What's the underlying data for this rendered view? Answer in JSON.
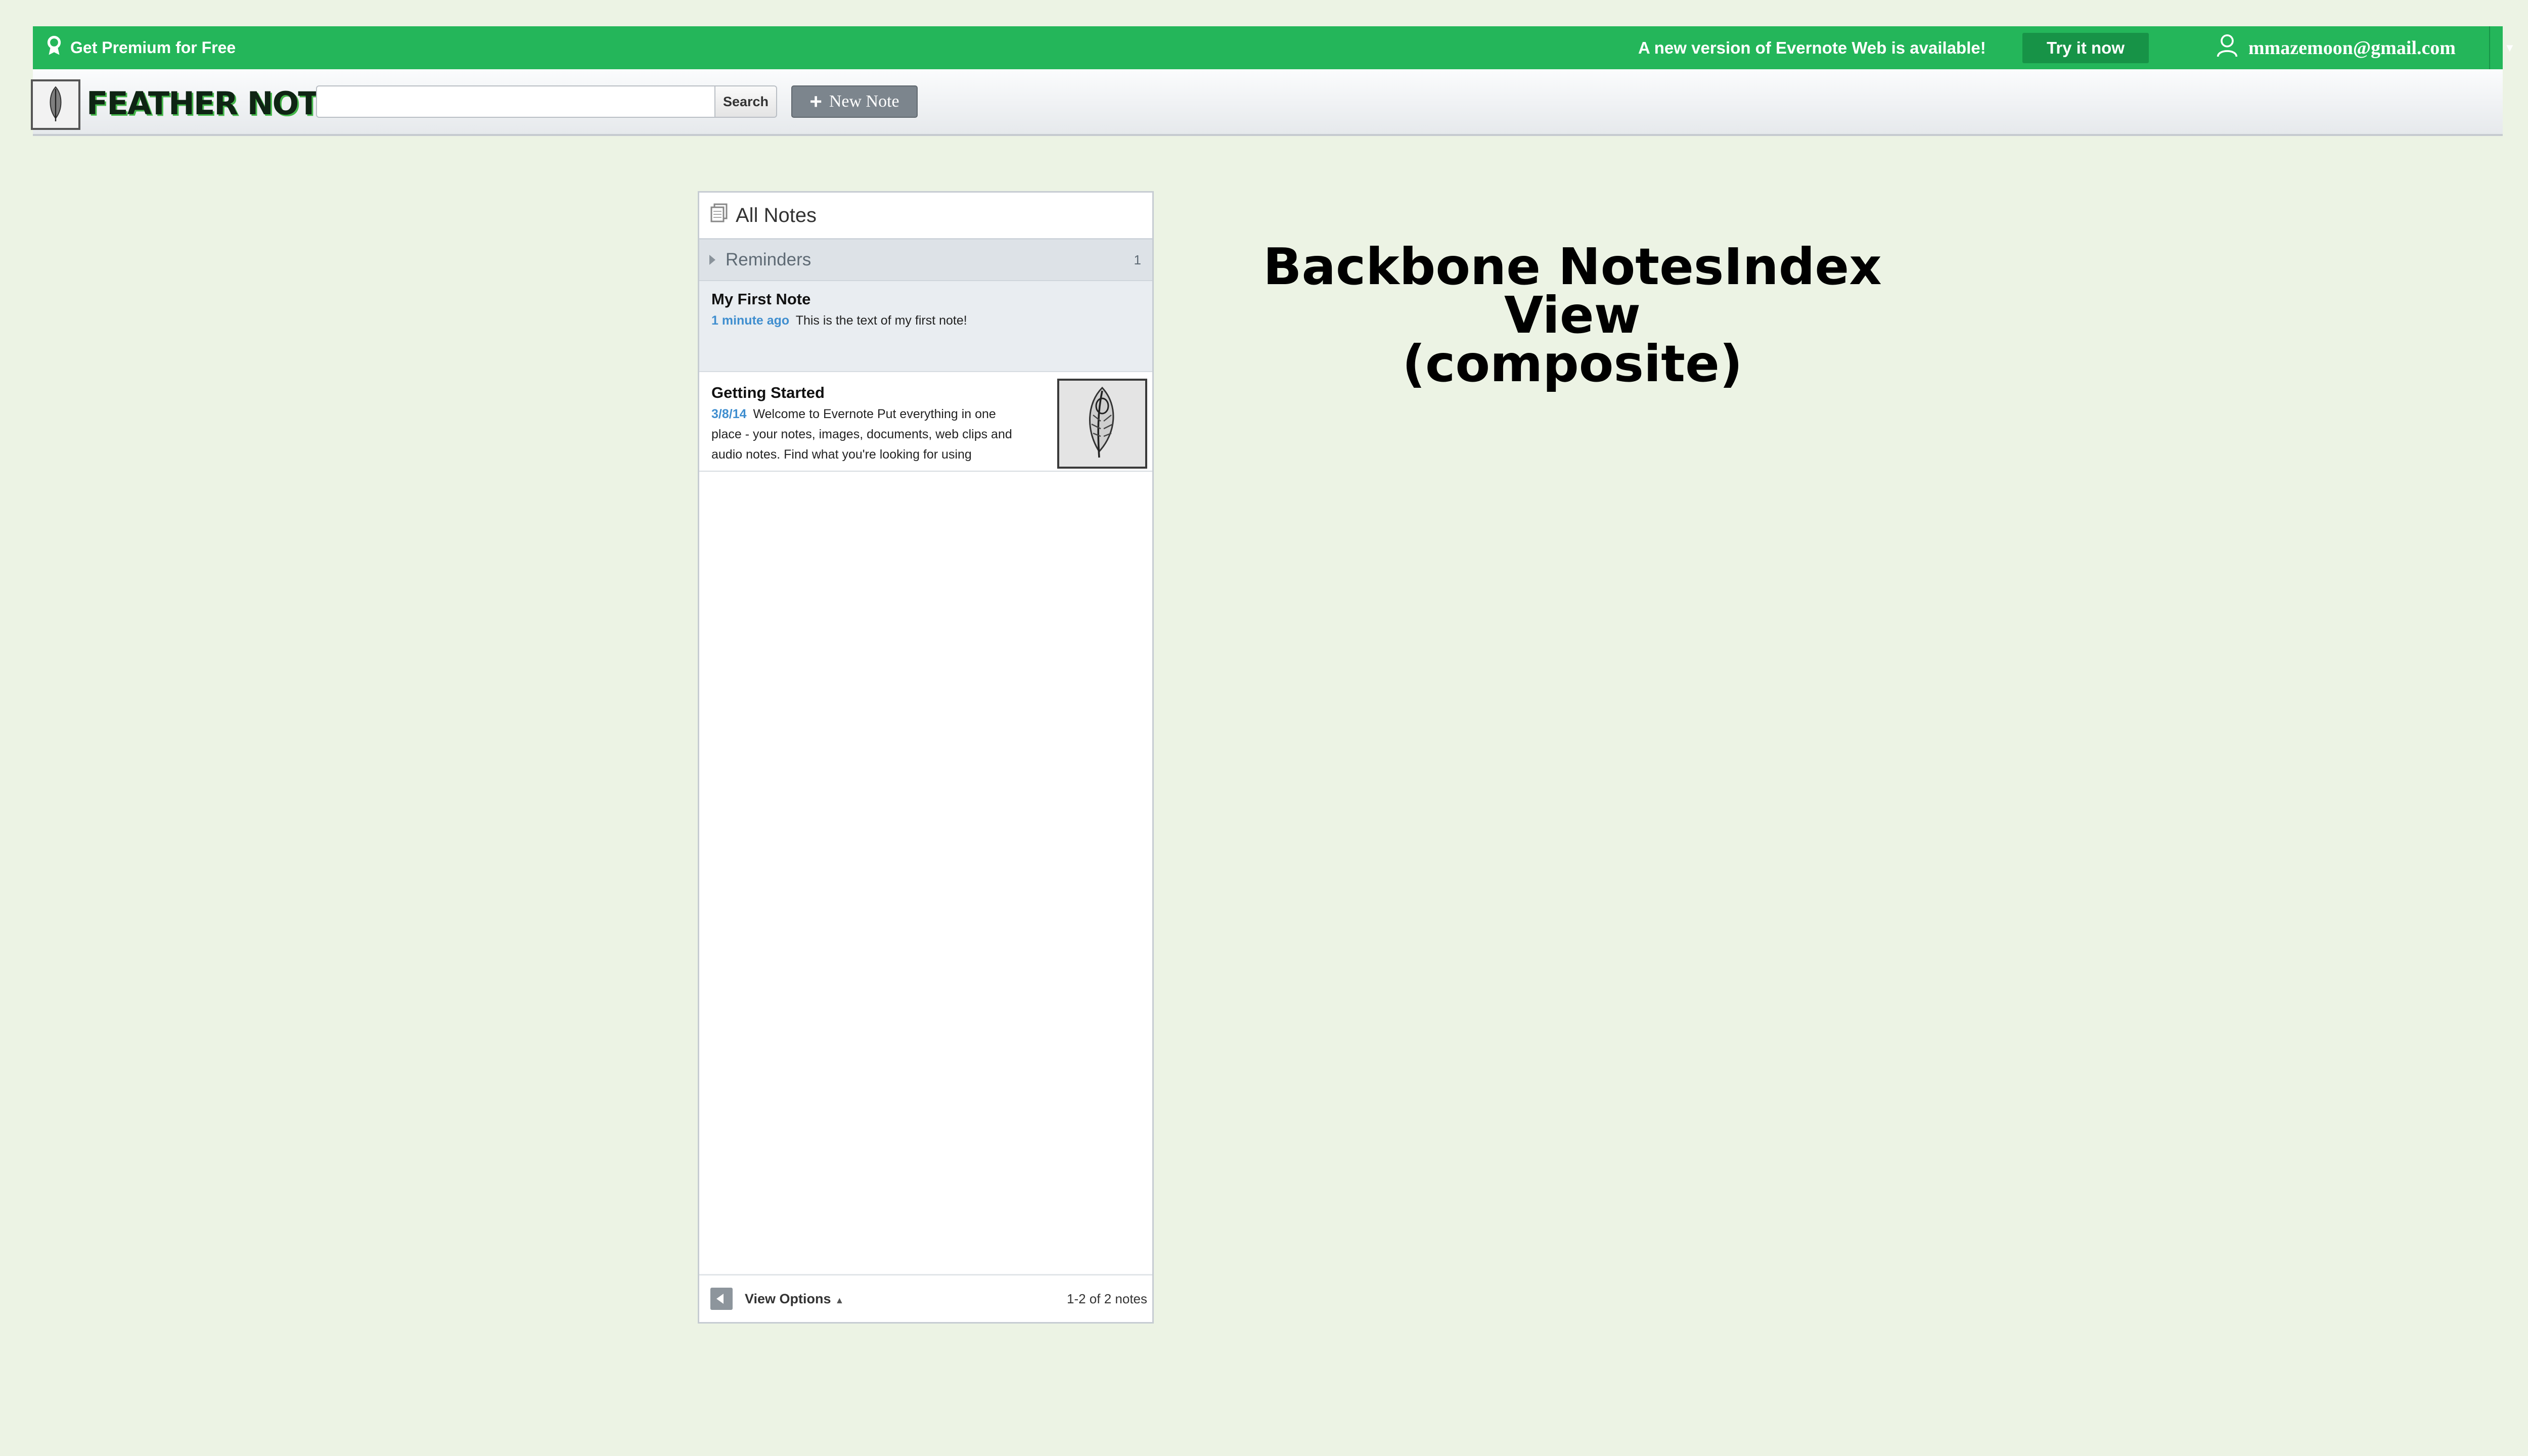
{
  "topbar": {
    "premium_label": "Get Premium for Free",
    "update_message": "A new version of Evernote Web is available!",
    "try_button": "Try it now",
    "user_email": "mmazemoon@gmail.com",
    "accent_color": "#24b65a"
  },
  "toolbar": {
    "logo_text": "FEATHER NOTE",
    "search_button": "Search",
    "search_value": "",
    "new_note_button": "New Note"
  },
  "notes_panel": {
    "header": "All Notes",
    "reminders": {
      "label": "Reminders",
      "count": "1"
    },
    "notes": [
      {
        "title": "My First Note",
        "date": "1 minute ago",
        "snippet": "This is the text of my first note!"
      },
      {
        "title": "Getting Started",
        "date": "3/8/14",
        "snippet": "Welcome to Evernote Put everything in one place - your notes, images, documents, web clips and audio notes. Find what you're looking for using",
        "thumbnail_icon": "feather-icon"
      }
    ],
    "footer": {
      "view_options": "View Options",
      "count_text": "1-2 of 2 notes"
    }
  },
  "slide": {
    "title_line1": "Backbone NotesIndex View",
    "title_line2": "(composite)"
  }
}
